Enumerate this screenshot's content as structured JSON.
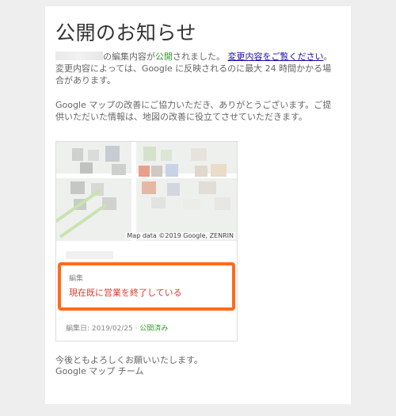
{
  "email": {
    "title": "公開のお知らせ",
    "intro": {
      "after_name": "の編集内容が",
      "status_word": "公開",
      "after_status": "されました。",
      "link_text": "変更内容をご覧ください",
      "after_link": "。変更内容によっては、Google に反映されるのに最大 24 時間かかる場合があります。"
    },
    "thanks": "Google マップの改善にご協力いただき、ありがとうございます。ご提供いただいた情報は、地図の改善に役立てさせていただきます。",
    "card": {
      "map_credit": "Map data ©2019 Google, ZENRIN",
      "edit_kind": "編集",
      "edit_value": "現在既に営業を終了している",
      "edit_date_prefix": "編集日: 2019/02/25 · ",
      "edit_status": "公開済み"
    },
    "closing": {
      "line1": "今後ともよろしくお願いいたします。",
      "line2": "Google マップ チーム"
    }
  },
  "colors": {
    "published_green": "#3a9b32",
    "link_blue": "#1a0dab",
    "highlight_orange": "#ff6a1a",
    "edit_red": "#d93b2f"
  }
}
